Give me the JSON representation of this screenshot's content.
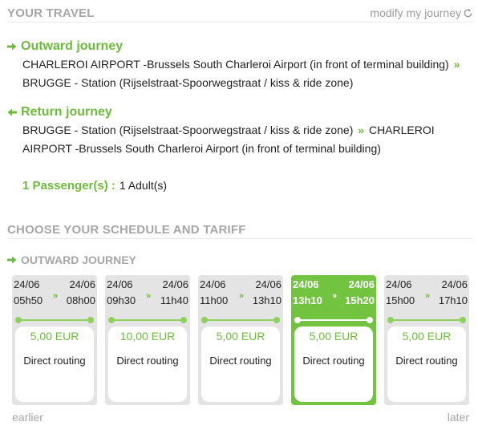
{
  "your_travel": {
    "title": "YOUR TRAVEL",
    "modify_label": "modify my journey"
  },
  "outward": {
    "title": "Outward journey",
    "from": "CHARLEROI AIRPORT -Brussels South Charleroi Airport (in front of terminal building)",
    "separator": "»",
    "to": "BRUGGE - Station (Rijselstraat-Spoorwegstraat / kiss & ride zone)"
  },
  "return": {
    "title": "Return journey",
    "from": "BRUGGE - Station (Rijselstraat-Spoorwegstraat / kiss & ride zone)",
    "separator": "»",
    "to": "CHARLEROI AIRPORT -Brussels South Charleroi Airport (in front of terminal building)"
  },
  "passengers": {
    "label": "1 Passenger(s) :",
    "value": "1 Adult(s)"
  },
  "schedule": {
    "title": "CHOOSE YOUR SCHEDULE AND TARIFF",
    "outward_title": "OUTWARD JOURNEY",
    "arrow_glyph": "»",
    "cards": [
      {
        "dep_date": "24/06",
        "dep_time": "05h50",
        "arr_date": "24/06",
        "arr_time": "08h00",
        "price": "5,00 EUR",
        "routing": "Direct routing",
        "selected": false
      },
      {
        "dep_date": "24/06",
        "dep_time": "09h30",
        "arr_date": "24/06",
        "arr_time": "11h40",
        "price": "10,00 EUR",
        "routing": "Direct routing",
        "selected": false
      },
      {
        "dep_date": "24/06",
        "dep_time": "11h00",
        "arr_date": "24/06",
        "arr_time": "13h10",
        "price": "5,00 EUR",
        "routing": "Direct routing",
        "selected": false
      },
      {
        "dep_date": "24/06",
        "dep_time": "13h10",
        "arr_date": "24/06",
        "arr_time": "15h20",
        "price": "5,00 EUR",
        "routing": "Direct routing",
        "selected": true
      },
      {
        "dep_date": "24/06",
        "dep_time": "15h00",
        "arr_date": "24/06",
        "arr_time": "17h10",
        "price": "5,00 EUR",
        "routing": "Direct routing",
        "selected": false
      }
    ],
    "earlier_label": "earlier",
    "later_label": "later"
  },
  "colors": {
    "accent": "#6dbb3c",
    "selected_card": "#72c33f",
    "card_bg": "#e4e4e4",
    "muted_text": "#a6a6a6"
  },
  "icons": {
    "journey_arrow": "right-arrow-icon",
    "modify": "refresh-icon"
  }
}
